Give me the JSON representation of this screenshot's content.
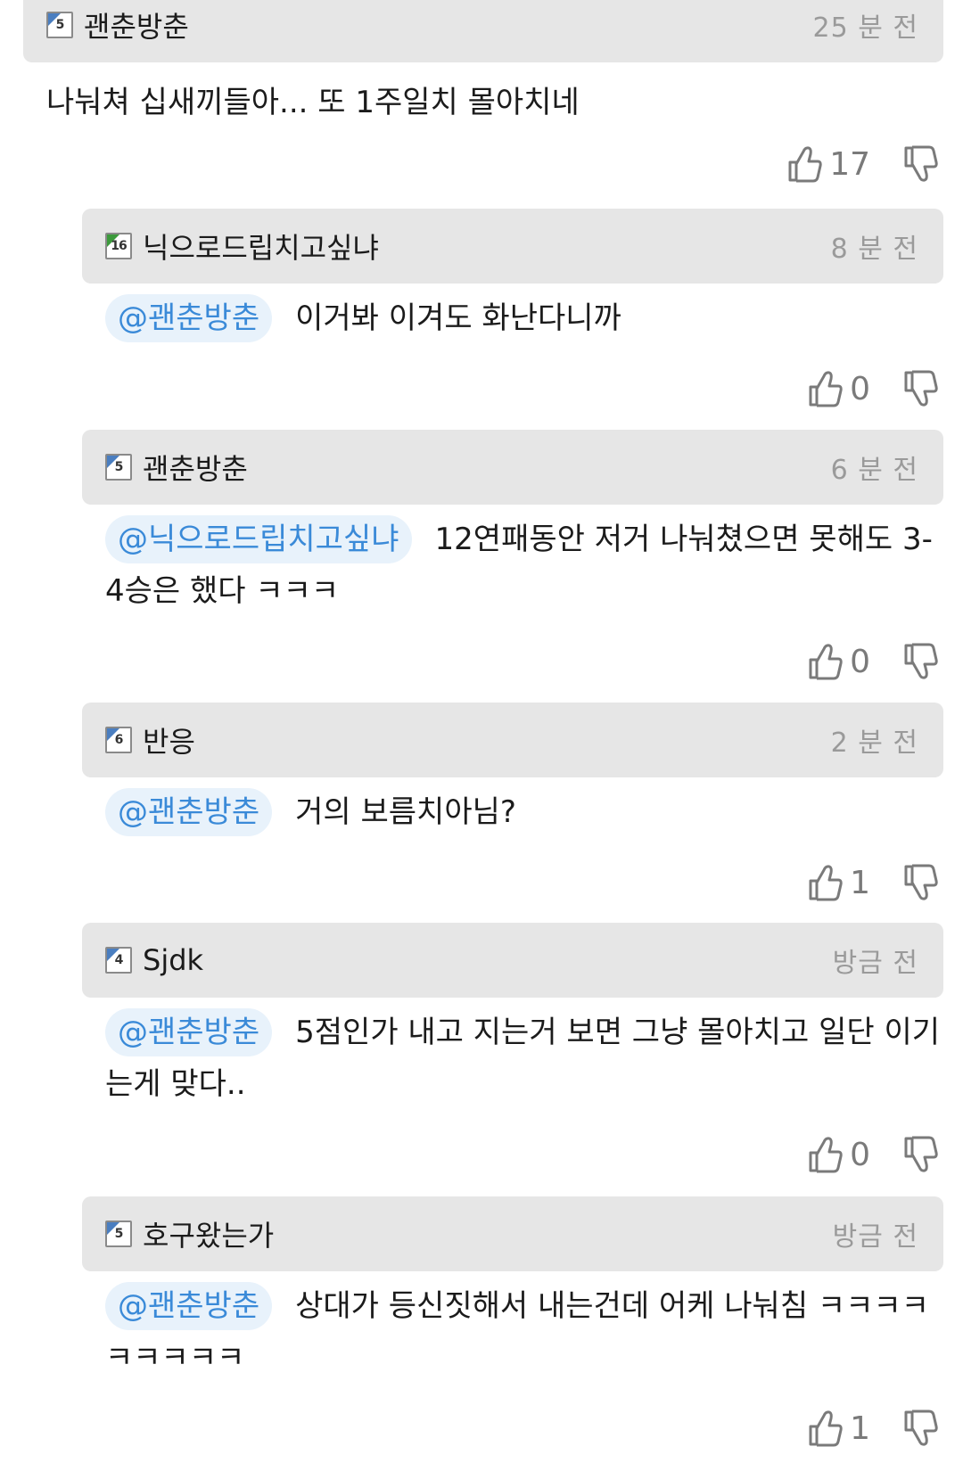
{
  "comments": [
    {
      "level": "5",
      "username": "괜춘방춘",
      "time": "25 분 전",
      "mention": "",
      "text": "나눠쳐 십새끼들아... 또 1주일치 몰아치네",
      "likes": "17"
    },
    {
      "level": "16",
      "username": "닉으로드립치고싶냐",
      "time": "8 분 전",
      "mention": "@괜춘방춘",
      "text": "이거봐 이겨도 화난다니까",
      "likes": "0"
    },
    {
      "level": "5",
      "username": "괜춘방춘",
      "time": "6 분 전",
      "mention": "@닉으로드립치고싶냐",
      "text": "12연패동안 저거 나눠쳤으면 못해도 3-4승은 했다 ㅋㅋㅋ",
      "likes": "0"
    },
    {
      "level": "6",
      "username": "반응",
      "time": "2 분 전",
      "mention": "@괜춘방춘",
      "text": "거의 보름치아님?",
      "likes": "1"
    },
    {
      "level": "4",
      "username": "Sjdk",
      "time": "방금 전",
      "mention": "@괜춘방춘",
      "text": "5점인가 내고 지는거 보면 그냥 몰아치고 일단 이기는게 맞다..",
      "likes": "0"
    },
    {
      "level": "5",
      "username": "호구왔는가",
      "time": "방금 전",
      "mention": "@괜춘방춘",
      "text": "상대가 등신짓해서 내는건데 어케 나눠침 ㅋㅋㅋㅋㅋㅋㅋㅋㅋ",
      "likes": "1"
    }
  ],
  "colors": {
    "header_bg": "#e6e6e6",
    "mention_bg": "#e8f2fb",
    "mention_text": "#3a8ad8",
    "badge_corner": "#4a7ec0",
    "meta_text": "#9a9a9a"
  },
  "icons": {
    "thumbs_up": "thumbs-up-icon",
    "thumbs_down": "thumbs-down-icon"
  }
}
